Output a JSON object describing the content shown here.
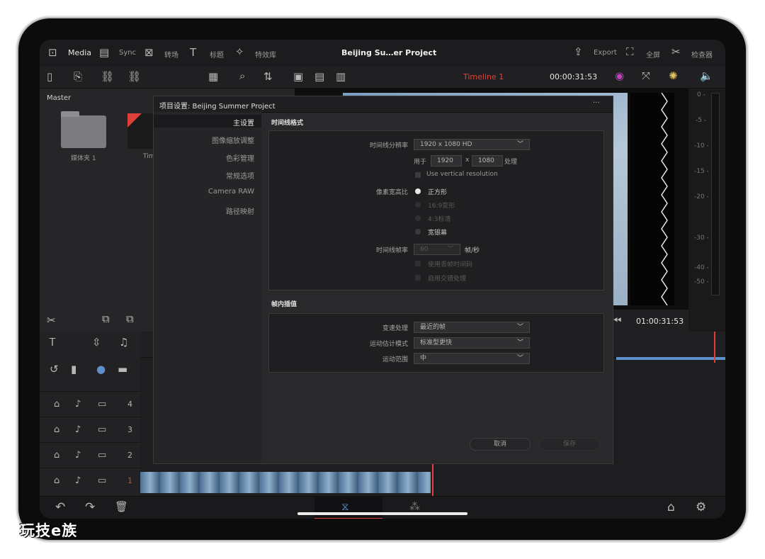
{
  "topbar": {
    "media_label": "Media",
    "sync_label": "Sync",
    "transition_label": "转场",
    "title_label": "标题",
    "effects_label": "特效库",
    "project_title": "Beijing Su…er Project",
    "export_label": "Export",
    "fullscreen_label": "全屏",
    "inspector_label": "检查器"
  },
  "toolbar": {
    "timeline_name": "Timeline 1",
    "timecode": "00:00:31:53"
  },
  "mediapool": {
    "title": "Master",
    "folder_label": "媒体夹 1",
    "clip_label": "Tim"
  },
  "dialog": {
    "title": "项目设置:  Beijing Summer Project",
    "more": "···",
    "sidebar": [
      "主设置",
      "图像缩放调整",
      "色彩管理",
      "常规选项",
      "Camera RAW",
      "路径映射"
    ],
    "section1_title": "时间线格式",
    "resolution_label": "时间线分辨率",
    "resolution_value": "1920 x 1080 HD",
    "use_for": "用于",
    "width": "1920",
    "x": "x",
    "height": "1080",
    "process": "处理",
    "vertical_res": "Use vertical resolution",
    "par_label": "像素宽高比",
    "par_options": [
      "正方形",
      "16:9变形",
      "4:3标清",
      "宽银幕"
    ],
    "fps_label": "时间线帧率",
    "fps_value": "60",
    "fps_unit": "帧/秒",
    "drop_frame": "使用丢帧时间码",
    "interlace": "启用交错处理",
    "section2_title": "帧内插值",
    "retime_label": "变速处理",
    "retime_value": "最近的帧",
    "motion_mode_label": "运动估计模式",
    "motion_mode_value": "标准型更快",
    "motion_range_label": "运动范围",
    "motion_range_value": "中",
    "cancel": "取消",
    "save": "保存"
  },
  "meter": {
    "ticks": [
      "0 -",
      "-5 -",
      "-10 -",
      "-15 -",
      "-20 -",
      "-30 -",
      "-40 -",
      "-50 -"
    ]
  },
  "timeline": {
    "timecode": "01:00:31:53",
    "tracks": [
      "4",
      "3",
      "2",
      "1"
    ]
  },
  "watermark": "玩技e族",
  "colors": {
    "accent_red": "#e0403a",
    "blue_clip": "#5d8fc8",
    "bg": "#1c1c1e"
  }
}
